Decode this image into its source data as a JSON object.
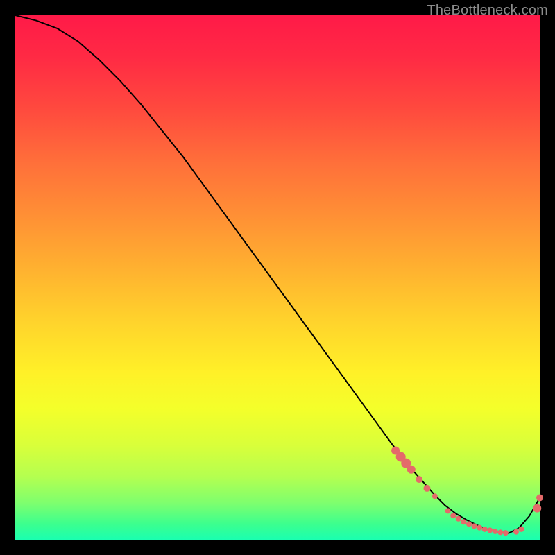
{
  "watermark": "TheBottleneck.com",
  "chart_data": {
    "type": "line",
    "title": "",
    "xlabel": "",
    "ylabel": "",
    "xlim": [
      0,
      100
    ],
    "ylim": [
      0,
      100
    ],
    "grid": false,
    "legend": false,
    "series": [
      {
        "name": "curve",
        "x": [
          0,
          4,
          8,
          12,
          16,
          20,
          24,
          28,
          32,
          36,
          40,
          44,
          48,
          52,
          56,
          60,
          64,
          68,
          72,
          76,
          80,
          82,
          84,
          86,
          88,
          90,
          92,
          94,
          96,
          98,
          100
        ],
        "y": [
          100,
          99,
          97.5,
          95,
          91.5,
          87.5,
          83,
          78,
          73,
          67.5,
          62,
          56.5,
          51,
          45.5,
          40,
          34.5,
          29,
          23.5,
          18,
          13,
          8.5,
          6.5,
          5,
          3.8,
          2.8,
          2,
          1.5,
          1.2,
          2.2,
          4.5,
          8
        ]
      }
    ],
    "markers": [
      {
        "x": 72.5,
        "y": 17.0,
        "r": 6
      },
      {
        "x": 73.5,
        "y": 15.8,
        "r": 7
      },
      {
        "x": 74.5,
        "y": 14.6,
        "r": 7
      },
      {
        "x": 75.5,
        "y": 13.4,
        "r": 6
      },
      {
        "x": 77.0,
        "y": 11.5,
        "r": 5
      },
      {
        "x": 78.5,
        "y": 9.8,
        "r": 5
      },
      {
        "x": 80.0,
        "y": 8.3,
        "r": 4
      },
      {
        "x": 82.5,
        "y": 5.5,
        "r": 4
      },
      {
        "x": 83.5,
        "y": 4.6,
        "r": 4
      },
      {
        "x": 84.5,
        "y": 4.0,
        "r": 4
      },
      {
        "x": 85.5,
        "y": 3.4,
        "r": 4
      },
      {
        "x": 86.5,
        "y": 3.0,
        "r": 4
      },
      {
        "x": 87.5,
        "y": 2.6,
        "r": 4
      },
      {
        "x": 88.5,
        "y": 2.3,
        "r": 4
      },
      {
        "x": 89.5,
        "y": 2.0,
        "r": 4
      },
      {
        "x": 90.5,
        "y": 1.8,
        "r": 4
      },
      {
        "x": 91.5,
        "y": 1.6,
        "r": 4
      },
      {
        "x": 92.5,
        "y": 1.4,
        "r": 4
      },
      {
        "x": 93.5,
        "y": 1.3,
        "r": 4
      },
      {
        "x": 95.5,
        "y": 1.5,
        "r": 4
      },
      {
        "x": 96.5,
        "y": 2.0,
        "r": 4
      },
      {
        "x": 99.5,
        "y": 6.0,
        "r": 6
      },
      {
        "x": 100.0,
        "y": 8.0,
        "r": 5
      }
    ],
    "annotations": []
  },
  "colors": {
    "background": "#000000",
    "curve": "#000000",
    "marker": "#e46a6a",
    "watermark": "#8c8c8c"
  }
}
